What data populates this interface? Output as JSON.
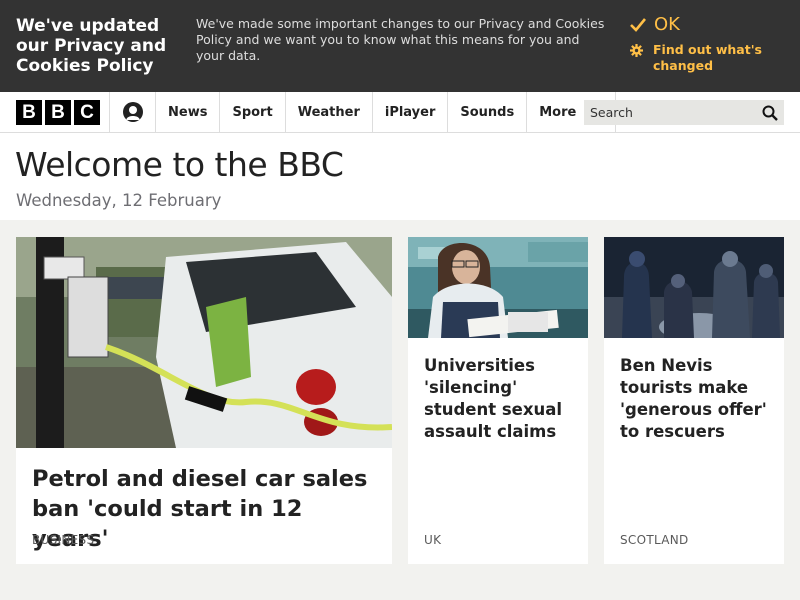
{
  "cookie_banner": {
    "title": "We've updated our Privacy and Cookies Policy",
    "text": "We've made some important changes to our Privacy and Cookies Policy and we want you to know what this means for you and your data.",
    "ok_label": "OK",
    "find_out_label": "Find out what's changed",
    "accent_color": "#ffbf47"
  },
  "nav": {
    "logo_letters": [
      "B",
      "B",
      "C"
    ],
    "account_icon": "account-icon",
    "links": [
      "News",
      "Sport",
      "Weather",
      "iPlayer",
      "Sounds"
    ],
    "more_label": "More",
    "search_placeholder": "Search"
  },
  "header": {
    "title": "Welcome to the BBC",
    "date": "Wednesday, 12 February"
  },
  "stories": [
    {
      "headline": "Petrol and diesel car sales ban 'could start in 12 years'",
      "tag": "BUSINESS",
      "image": "electric-car-charging-image"
    },
    {
      "headline": "Universities 'silencing' student sexual assault claims",
      "tag": "UK",
      "image": "student-studying-image"
    },
    {
      "headline": "Ben Nevis tourists make 'generous offer' to rescuers",
      "tag": "SCOTLAND",
      "image": "mountain-rescue-night-image"
    }
  ]
}
